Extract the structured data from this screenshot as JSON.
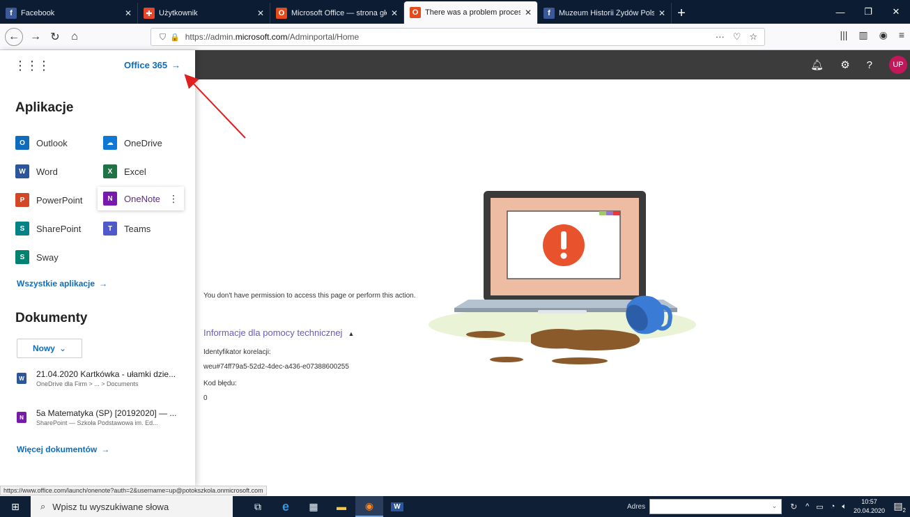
{
  "browser": {
    "tabs": [
      {
        "label": "Facebook",
        "icon": "facebook-icon",
        "color": "#3b5998",
        "glyph": "f"
      },
      {
        "label": "Użytkownik",
        "icon": "flag-icon",
        "color": "#e8462b",
        "glyph": "✚"
      },
      {
        "label": "Microsoft Office — strona głów",
        "icon": "office-icon",
        "color": "#e64a19",
        "glyph": "O"
      },
      {
        "label": "There was a problem processin",
        "icon": "office-icon",
        "color": "#e64a19",
        "glyph": "O",
        "active": true
      },
      {
        "label": "Muzeum Historii Żydów Polskic",
        "icon": "facebook-icon",
        "color": "#3b5998",
        "glyph": "f"
      }
    ],
    "url_prefix": "https://admin.",
    "url_domain": "microsoft.com",
    "url_path": "/Adminportal/Home"
  },
  "launcher": {
    "brand_link": "Office 365",
    "apps_title": "Aplikacje",
    "apps": [
      {
        "label": "Outlook",
        "icon": "outlook-icon",
        "color": "#0f6cbd",
        "glyph": "O"
      },
      {
        "label": "OneDrive",
        "icon": "onedrive-icon",
        "color": "#0f78d4",
        "glyph": "☁"
      },
      {
        "label": "Word",
        "icon": "word-icon",
        "color": "#2b579a",
        "glyph": "W"
      },
      {
        "label": "Excel",
        "icon": "excel-icon",
        "color": "#217346",
        "glyph": "X"
      },
      {
        "label": "PowerPoint",
        "icon": "powerpoint-icon",
        "color": "#d24726",
        "glyph": "P"
      },
      {
        "label": "OneNote",
        "icon": "onenote-icon",
        "color": "#7719aa",
        "glyph": "N"
      },
      {
        "label": "SharePoint",
        "icon": "sharepoint-icon",
        "color": "#038387",
        "glyph": "S"
      },
      {
        "label": "Teams",
        "icon": "teams-icon",
        "color": "#5059c9",
        "glyph": "T"
      },
      {
        "label": "Sway",
        "icon": "sway-icon",
        "color": "#008272",
        "glyph": "S"
      }
    ],
    "all_apps_link": "Wszystkie aplikacje",
    "docs_title": "Dokumenty",
    "new_button": "Nowy",
    "docs": [
      {
        "title": "21.04.2020 Kartkówka - ułamki dzie...",
        "sub": "OneDrive dla Firm > ... > Documents",
        "icon": "word-doc-icon",
        "color": "#2b579a",
        "glyph": "W"
      },
      {
        "title": "5a Matematyka (SP) [20192020] — ...",
        "sub": "SharePoint — Szkoła Podstawowa im. Ed...",
        "icon": "onenote-doc-icon",
        "color": "#7719aa",
        "glyph": "N"
      }
    ],
    "more_docs_link": "Więcej dokumentów"
  },
  "appbar": {
    "avatar_initials": "UP"
  },
  "main": {
    "message": "You don't have permission to access this page or perform this action.",
    "support_link": "Informacje dla pomocy technicznej",
    "correlation_label": "Identyfikator korelacji:",
    "correlation_value": "weu#74ff79a5-52d2-4dec-a436-e07388600255",
    "error_code_label": "Kod błędu:",
    "error_code_value": "0"
  },
  "status_url": "https://www.office.com/launch/onenote?auth=2&username=up@potokszkola.onmicrosoft.com",
  "taskbar": {
    "search_placeholder": "Wpisz tu wyszukiwane słowa",
    "address_label": "Adres",
    "time": "10:57",
    "date": "20.04.2020",
    "notification_count": "2"
  }
}
